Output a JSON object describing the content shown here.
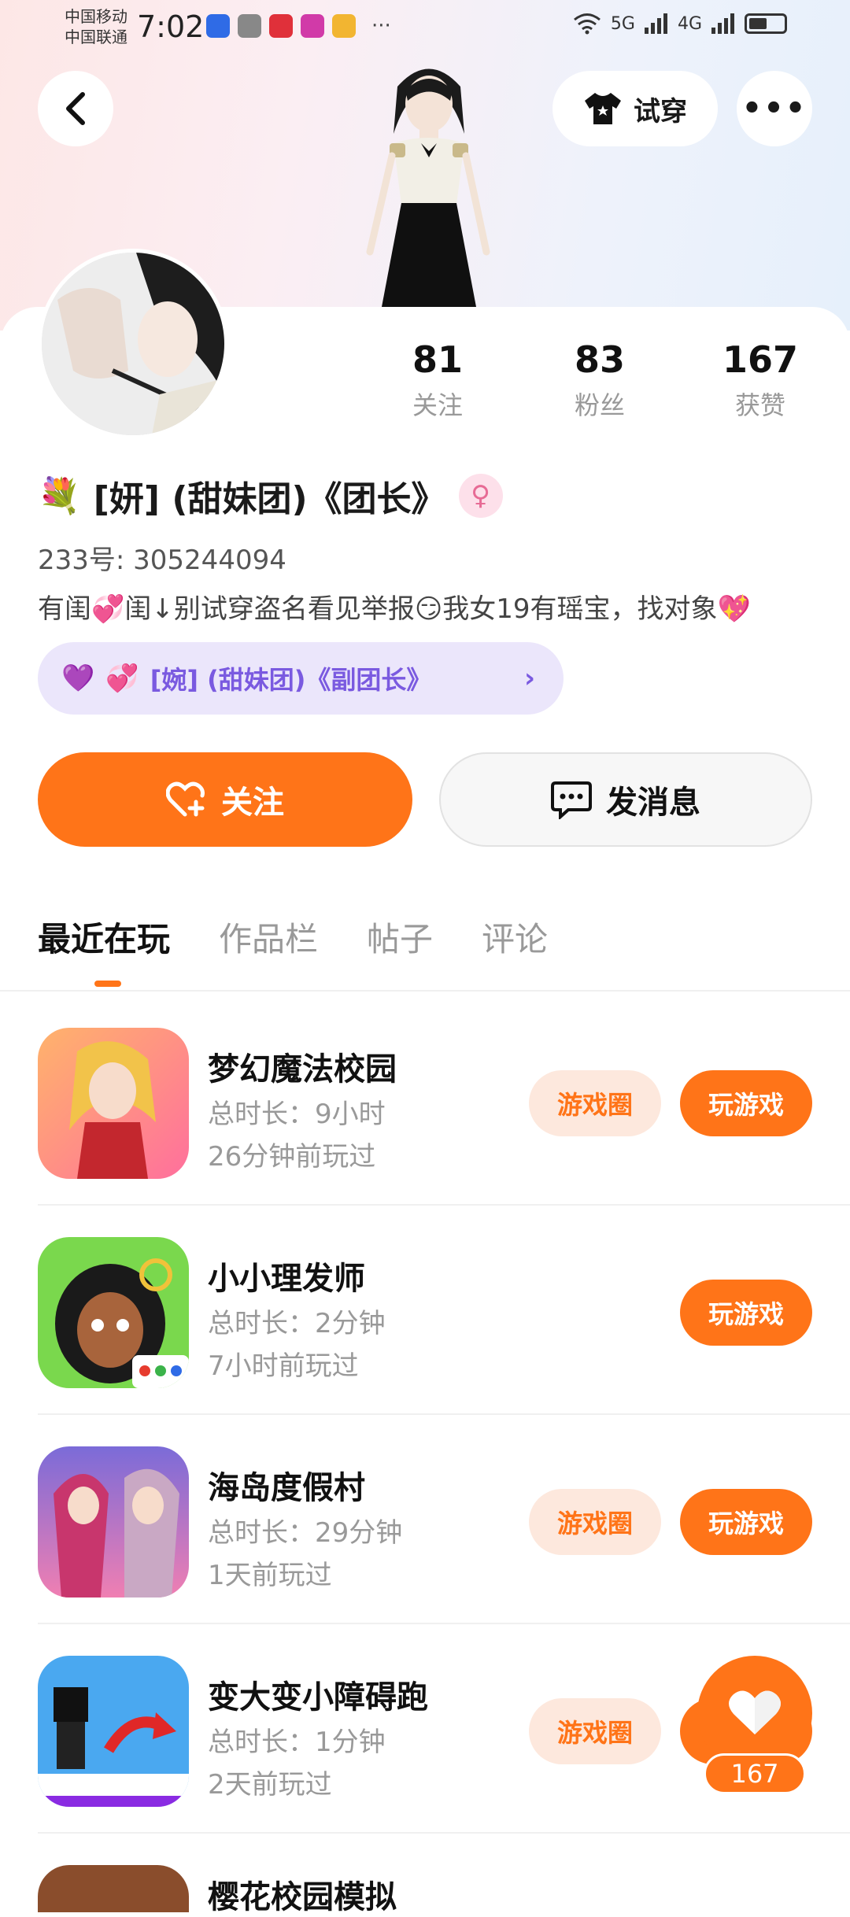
{
  "status_bar": {
    "carrier_1": "中国移动",
    "carrier_2": "中国联通",
    "time": "7:02",
    "network_1": "5G",
    "network_2": "4G"
  },
  "header": {
    "try_on_label": "试穿",
    "more_label": "•••"
  },
  "profile": {
    "stats": [
      {
        "value": "81",
        "label": "关注"
      },
      {
        "value": "83",
        "label": "粉丝"
      },
      {
        "value": "167",
        "label": "获赞"
      }
    ],
    "nickname": "[妍] (甜妹团)《团长》",
    "uid_text": "233号: 305244094",
    "bio": "有闺💞闺↓别试穿盗名看见举报😏我女19有瑶宝，找对象💖",
    "relation_label": "[婉] (甜妹团)《副团长》",
    "gender_symbol": "♀"
  },
  "actions": {
    "follow_label": "关注",
    "message_label": "发消息"
  },
  "tabs": [
    "最近在玩",
    "作品栏",
    "帖子",
    "评论"
  ],
  "games": [
    {
      "title": "梦幻魔法校园",
      "duration": "总时长：9小时",
      "last_played": "26分钟前玩过",
      "circle_label": "游戏圈",
      "play_label": "玩游戏",
      "has_circle": true
    },
    {
      "title": "小小理发师",
      "duration": "总时长：2分钟",
      "last_played": "7小时前玩过",
      "circle_label": "",
      "play_label": "玩游戏",
      "has_circle": false
    },
    {
      "title": "海岛度假村",
      "duration": "总时长：29分钟",
      "last_played": "1天前玩过",
      "circle_label": "游戏圈",
      "play_label": "玩游戏",
      "has_circle": true
    },
    {
      "title": "变大变小障碍跑",
      "duration": "总时长：1分钟",
      "last_played": "2天前玩过",
      "circle_label": "游戏圈",
      "play_label": "玩游戏",
      "has_circle": true
    }
  ],
  "peek_game_title": "樱花校园模拟",
  "like_float": {
    "count": "167"
  },
  "colors": {
    "accent": "#ff7418",
    "accent_light": "#fde8dd",
    "relation_bg": "#ebe6fb",
    "relation_text": "#7a5ae0"
  }
}
